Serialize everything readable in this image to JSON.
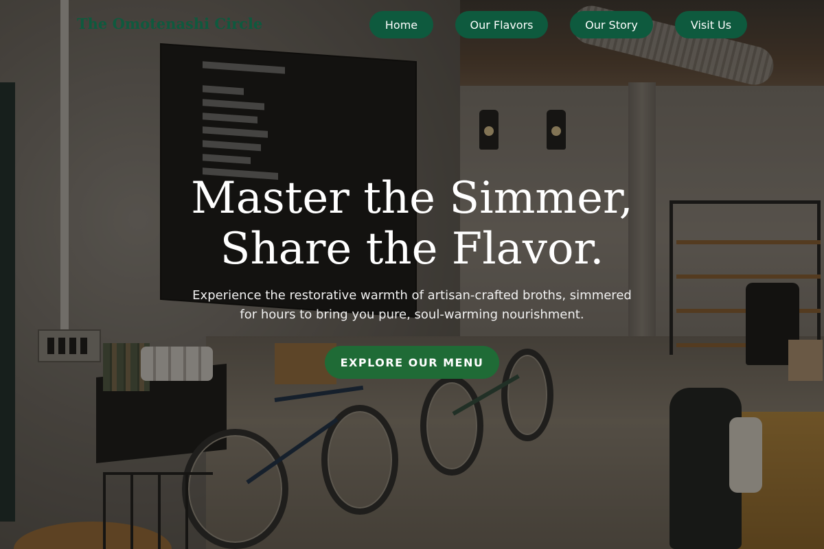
{
  "header": {
    "brand": "The Omotenashi Circle",
    "nav": [
      {
        "label": "Home"
      },
      {
        "label": "Our Flavors"
      },
      {
        "label": "Our Story"
      },
      {
        "label": "Visit Us"
      }
    ]
  },
  "hero": {
    "title_line1": "Master the Simmer,",
    "title_line2": "Share the Flavor.",
    "subtitle_line1": "Experience the restorative warmth of artisan-crafted broths, simmered",
    "subtitle_line2": "for hours to bring you pure, soul-warming nourishment.",
    "cta_label": "EXPLORE OUR MENU"
  },
  "colors": {
    "brand_green": "#0e5a3e",
    "cta_green": "#1f6b36",
    "hero_text": "#ffffff"
  }
}
